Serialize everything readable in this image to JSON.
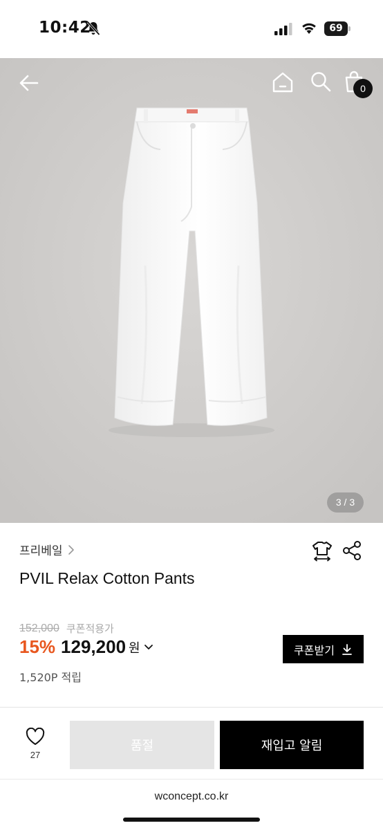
{
  "status_bar": {
    "time": "10:42",
    "battery": "69",
    "icons": [
      "bell-slash-icon",
      "signal-icon",
      "wifi-icon",
      "battery-icon"
    ]
  },
  "nav": {
    "icons": [
      "back-arrow-icon",
      "home-icon",
      "search-icon",
      "shopping-bag-icon"
    ],
    "cart_count": "0"
  },
  "gallery": {
    "pager": "3 / 3",
    "background_color": "#cfcdcb"
  },
  "product": {
    "brand": "프리베일",
    "title": "PVIL Relax Cotton Pants",
    "original_price": "152,000",
    "coupon_label": "쿠폰적용가",
    "discount": "15%",
    "price": "129,200",
    "currency": "원",
    "points": "1,520P 적립",
    "coupon_button": "쿠폰받기"
  },
  "bottom_bar": {
    "wish_count": "27",
    "soldout_label": "품절",
    "restock_label": "재입고 알림"
  },
  "browser": {
    "url": "wconcept.co.kr"
  },
  "colors": {
    "accent_discount": "#e8571f",
    "primary": "#000000",
    "disabled": "#e5e5e5"
  }
}
